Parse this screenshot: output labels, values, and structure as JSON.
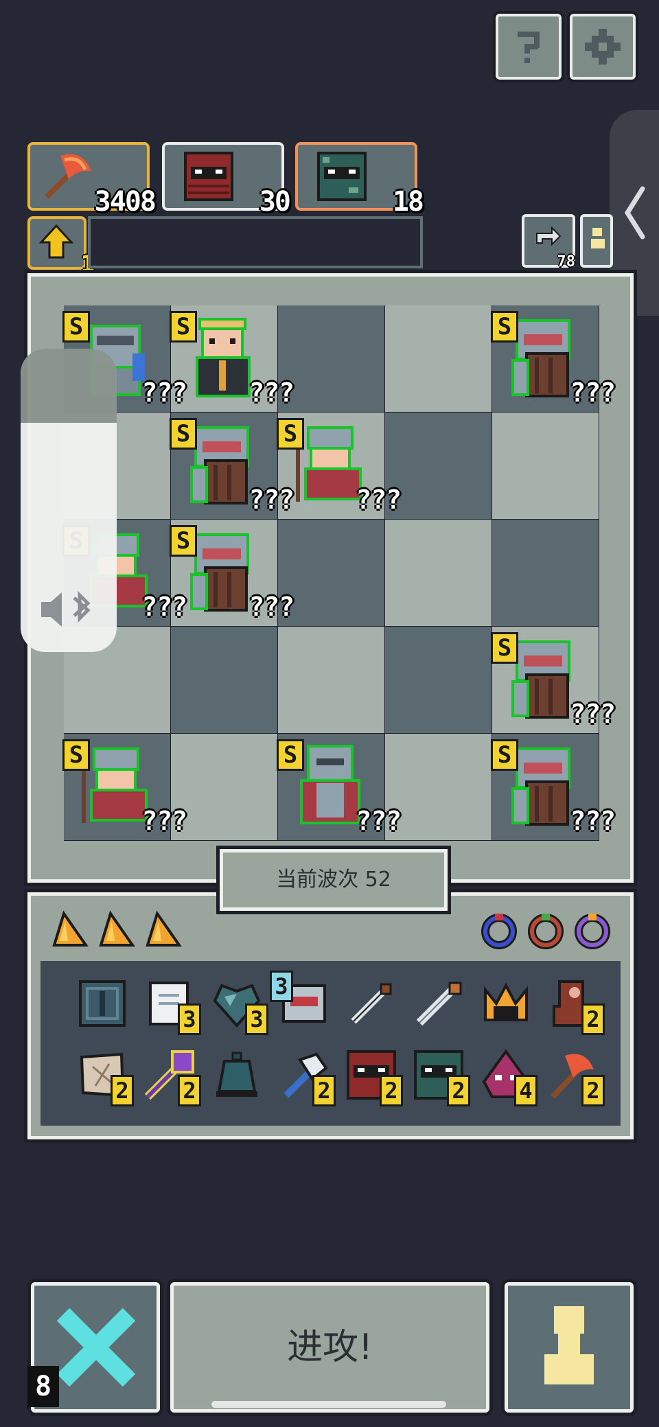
{
  "top_buttons": {
    "help_icon": "help-icon",
    "settings_icon": "gear-icon"
  },
  "resources": [
    {
      "icon": "axe-icon",
      "value": "3408",
      "border": "#e9b43c"
    },
    {
      "icon": "red-monster-icon",
      "value": "30",
      "border": "#e9ecea"
    },
    {
      "icon": "green-monster-icon",
      "value": "18",
      "border": "#f0935a"
    }
  ],
  "upgrade": {
    "icon": "upgrade-arrow-icon",
    "level": "1"
  },
  "side_counters": {
    "refresh_count": "78"
  },
  "units": [
    {
      "badge": "S",
      "label": "???"
    },
    {
      "badge": "S",
      "label": "???"
    },
    {
      "badge": "S",
      "label": "???"
    },
    {
      "badge": "S",
      "label": "???"
    },
    {
      "badge": "S",
      "label": "???"
    },
    {
      "badge": "S",
      "label": "???"
    },
    {
      "badge": "S",
      "label": "???"
    },
    {
      "badge": "S",
      "label": "???"
    },
    {
      "badge": "S",
      "label": "???"
    },
    {
      "badge": "S",
      "label": "???"
    },
    {
      "badge": "S",
      "label": "???"
    }
  ],
  "wave": {
    "label": "当前波次 52"
  },
  "inventory": {
    "row1": [
      {
        "icon": "crate-icon",
        "count": ""
      },
      {
        "icon": "scroll-icon",
        "count": "3"
      },
      {
        "icon": "heart-gem-icon",
        "count": "3"
      },
      {
        "icon": "robot-icon",
        "count": "3"
      },
      {
        "icon": "dagger-icon",
        "count": ""
      },
      {
        "icon": "sword-icon",
        "count": ""
      },
      {
        "icon": "crown-icon",
        "count": ""
      },
      {
        "icon": "boot-icon",
        "count": "2"
      }
    ],
    "row2": [
      {
        "icon": "map-icon",
        "count": "2"
      },
      {
        "icon": "staff-icon",
        "count": "2"
      },
      {
        "icon": "bell-icon",
        "count": ""
      },
      {
        "icon": "hammer-icon",
        "count": "2"
      },
      {
        "icon": "red-monster-icon",
        "count": "2"
      },
      {
        "icon": "green-monster-icon",
        "count": "2"
      },
      {
        "icon": "demon-icon",
        "count": "4"
      },
      {
        "icon": "axe-icon",
        "count": "2"
      }
    ]
  },
  "bottom": {
    "attack_label": "进攻!",
    "badge": "8"
  }
}
